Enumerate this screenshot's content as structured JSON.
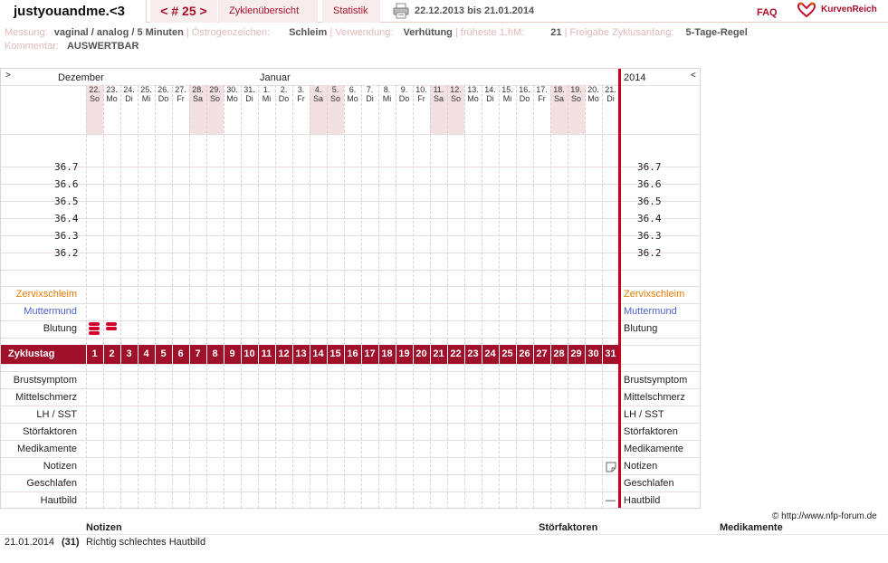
{
  "app": {
    "title": "justyouandme.<3"
  },
  "nav": {
    "cycle_label": "< # 25 >",
    "tab_overview": "Zyklenübersicht",
    "tab_stats": "Statistik",
    "print_icon": "printer-icon",
    "date_range": "22.12.2013 bis 21.01.2014",
    "faq": "FAQ",
    "logo_text": "KurvenReich"
  },
  "info": {
    "messung_label": "Messung:",
    "messung_value": "vaginal / analog / 5 Minuten",
    "oestrogen_label": "Östrogenzeichen:",
    "oestrogen_value": "Schleim",
    "verwendung_label": "Verwendung:",
    "verwendung_value": "Verhütung",
    "hm_label": "früheste 1.hM:",
    "hm_value": "21",
    "freigabe_label": "Freigabe Zyklusanfang:",
    "freigabe_value": "5-Tage-Regel",
    "kommentar_label": "Kommentar:",
    "kommentar_value": "AUSWERTBAR"
  },
  "chart": {
    "left_arrow": ">",
    "right_arrow": "<",
    "month1": "Dezember",
    "month2": "Januar",
    "year": "2014",
    "days": [
      {
        "d": "22.",
        "w": "So",
        "we": true
      },
      {
        "d": "23.",
        "w": "Mo",
        "we": false
      },
      {
        "d": "24.",
        "w": "Di",
        "we": false
      },
      {
        "d": "25.",
        "w": "Mi",
        "we": false
      },
      {
        "d": "26.",
        "w": "Do",
        "we": false
      },
      {
        "d": "27.",
        "w": "Fr",
        "we": false
      },
      {
        "d": "28.",
        "w": "Sa",
        "we": true
      },
      {
        "d": "29.",
        "w": "So",
        "we": true
      },
      {
        "d": "30.",
        "w": "Mo",
        "we": false
      },
      {
        "d": "31.",
        "w": "Di",
        "we": false
      },
      {
        "d": "1.",
        "w": "Mi",
        "we": false
      },
      {
        "d": "2.",
        "w": "Do",
        "we": false
      },
      {
        "d": "3.",
        "w": "Fr",
        "we": false
      },
      {
        "d": "4.",
        "w": "Sa",
        "we": true
      },
      {
        "d": "5.",
        "w": "So",
        "we": true
      },
      {
        "d": "6.",
        "w": "Mo",
        "we": false
      },
      {
        "d": "7.",
        "w": "Di",
        "we": false
      },
      {
        "d": "8.",
        "w": "Mi",
        "we": false
      },
      {
        "d": "9.",
        "w": "Do",
        "we": false
      },
      {
        "d": "10.",
        "w": "Fr",
        "we": false
      },
      {
        "d": "11.",
        "w": "Sa",
        "we": true
      },
      {
        "d": "12.",
        "w": "So",
        "we": true
      },
      {
        "d": "13.",
        "w": "Mo",
        "we": false
      },
      {
        "d": "14.",
        "w": "Di",
        "we": false
      },
      {
        "d": "15.",
        "w": "Mi",
        "we": false
      },
      {
        "d": "16.",
        "w": "Do",
        "we": false
      },
      {
        "d": "17.",
        "w": "Fr",
        "we": false
      },
      {
        "d": "18.",
        "w": "Sa",
        "we": true
      },
      {
        "d": "19.",
        "w": "So",
        "we": true
      },
      {
        "d": "20.",
        "w": "Mo",
        "we": false
      },
      {
        "d": "21.",
        "w": "Di",
        "we": false
      }
    ],
    "temps": [
      "36.7",
      "36.6",
      "36.5",
      "36.4",
      "36.3",
      "36.2"
    ],
    "rows_left": [
      "Zervixschleim",
      "Muttermund",
      "Blutung"
    ],
    "row_colors": [
      "#e67a00",
      "#4a5fc8",
      "#222222"
    ],
    "cycle_label": "Zyklustag",
    "cycle_days": [
      "1",
      "2",
      "3",
      "4",
      "5",
      "6",
      "7",
      "8",
      "9",
      "10",
      "11",
      "12",
      "13",
      "14",
      "15",
      "16",
      "17",
      "18",
      "19",
      "20",
      "21",
      "22",
      "23",
      "24",
      "25",
      "26",
      "27",
      "28",
      "29",
      "30",
      "31"
    ],
    "rows_bottom": [
      "Brustsymptom",
      "Mittelschmerz",
      "LH / SST",
      "Störfaktoren",
      "Medikamente",
      "Notizen",
      "Geschlafen",
      "Hautbild"
    ],
    "bleeding": [
      {
        "day": 1,
        "level": 3
      },
      {
        "day": 2,
        "level": 2
      }
    ],
    "note_day": 31,
    "note_icon": "note-icon",
    "hautbild_day": 31,
    "hautbild_mark": "—"
  },
  "footer": {
    "copyright": "© http://www.nfp-forum.de",
    "h_notizen": "Notizen",
    "h_stoer": "Störfaktoren",
    "h_medi": "Medikamente",
    "entry_date": "21.01.2014",
    "entry_day": "(31)",
    "entry_text": "Richtig schlechtes Hautbild"
  },
  "colors": {
    "accent": "#a8102a",
    "cyclebar": "#a0102a",
    "redline": "#c8001e"
  }
}
